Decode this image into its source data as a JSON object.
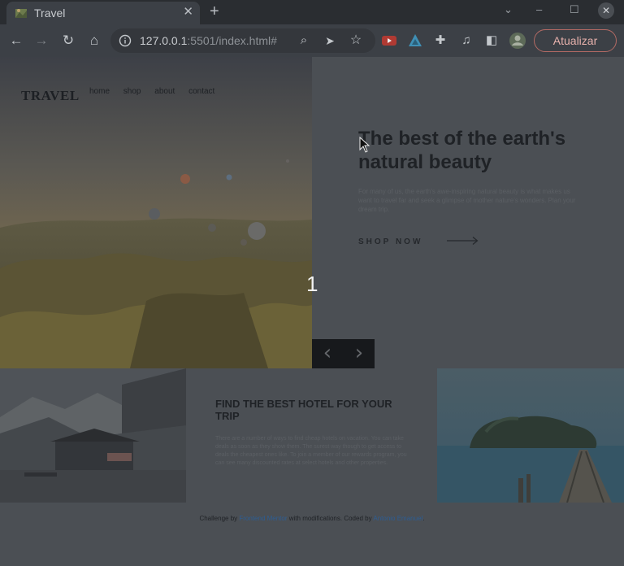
{
  "browser": {
    "tab_title": "Travel",
    "tab_close": "✕",
    "new_tab": "+",
    "url_host": "127.0.0.1",
    "url_rest": ":5501/index.html#",
    "update_label": "Atualizar",
    "icons": [
      "back-icon",
      "forward-icon",
      "reload-icon",
      "home-icon",
      "info-icon",
      "zoom-icon",
      "send-icon",
      "star-icon",
      "youtube-ext-icon",
      "ext-icon",
      "puzzle-icon",
      "media-icon",
      "sidepanel-icon",
      "profile-icon",
      "more-icon"
    ]
  },
  "site": {
    "logo": "TRAVEL",
    "nav": [
      "home",
      "shop",
      "about",
      "contact"
    ],
    "slide_number": "1",
    "prev_arrow": "‹",
    "next_arrow": "›",
    "hero_title": "The best of the earth's natural beauty",
    "hero_text": "For many of us, the earth's awe-inspiring natural beauty is what makes us want to travel far and seek a glimpse of mother nature's wonders. Plan your dream trip.",
    "shop_now": "SHOP NOW",
    "hotel_title": "FIND THE BEST HOTEL FOR YOUR TRIP",
    "hotel_text": "There are a number of ways to find cheap hotels on vacation. You can take deals as soon as they show them. The surest way though to get access to deals the cheapest ones like. To join a member of our rewards program, you can see many discounted rates at select hotels and other properties.",
    "footer_prefix": "Challenge by ",
    "footer_link1": "Frontend Mentor",
    "footer_mid": " with modifications. Coded by ",
    "footer_link2": "Antonio Emanuel",
    "footer_suffix": "."
  }
}
